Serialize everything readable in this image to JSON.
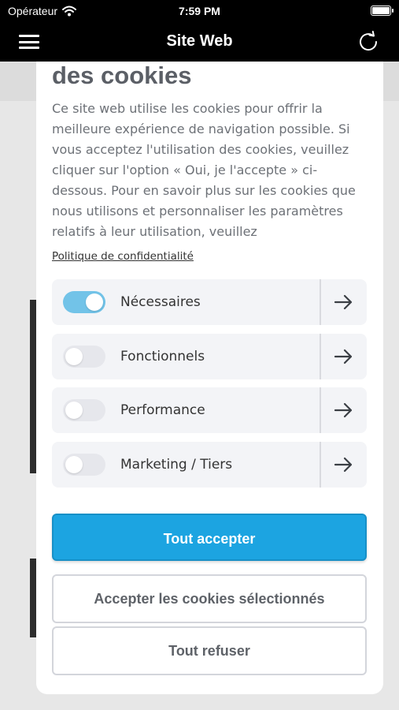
{
  "status_bar": {
    "carrier": "Opérateur",
    "time": "7:59 PM"
  },
  "nav": {
    "title": "Site Web"
  },
  "modal": {
    "title": "des cookies",
    "description": "Ce site web utilise les cookies pour offrir la meilleure expérience de navigation possible. Si vous acceptez l'utilisation des cookies, veuillez cliquer sur l'option « Oui, je l'accepte » ci-dessous. Pour en savoir plus sur les cookies que nous utilisons et personnaliser les paramètres relatifs à leur utilisation, veuillez",
    "privacy_link": "Politique de confidentialité",
    "categories": [
      {
        "label": "Nécessaires",
        "enabled": true
      },
      {
        "label": "Fonctionnels",
        "enabled": false
      },
      {
        "label": "Performance",
        "enabled": false
      },
      {
        "label": "Marketing / Tiers",
        "enabled": false
      }
    ],
    "buttons": {
      "accept_all": "Tout accepter",
      "accept_selected": "Accepter les cookies sélectionnés",
      "refuse_all": "Tout refuser"
    }
  },
  "icons": {
    "menu": "hamburger-icon",
    "reload": "reload-icon",
    "wifi": "wifi-icon",
    "battery": "battery-icon",
    "arrow": "arrow-right-icon"
  },
  "colors": {
    "accent": "#1ca4e1",
    "toggle_on": "#72c3e8",
    "bar": "#000000"
  }
}
